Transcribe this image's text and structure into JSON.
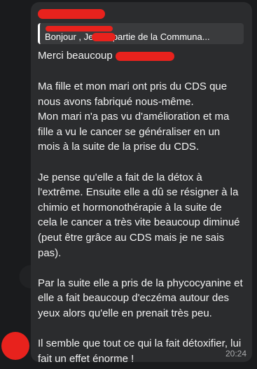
{
  "reply": {
    "text": "Bonjour , Je fais partie de la Communa..."
  },
  "message": {
    "greeting": "Merci beaucoup",
    "paragraphs": [
      "Ma fille et mon mari ont pris du CDS que nous avons fabriqué nous-même.\nMon mari n'a pas vu d'amélioration et ma fille a vu le cancer se généraliser en un mois à la suite de la prise du CDS.",
      "Je pense qu'elle a fait de la détox à l'extrême. Ensuite elle a dû se résigner à la chimio et hormonothérapie à la suite de cela le cancer a très vite beaucoup diminué (peut être grâce au CDS mais je ne sais pas).",
      "Par la suite elle a pris de la phycocyanine et elle a fait beaucoup d'eczéma autour des yeux alors qu'elle en prenait très peu.",
      "Il semble que tout ce qui la fait détoxifier, lui fait un effet énorme !"
    ],
    "time": "20:24"
  },
  "colors": {
    "redaction": "#e8221d",
    "bubble": "#2b2c2e",
    "background": "#1a1b1d"
  }
}
